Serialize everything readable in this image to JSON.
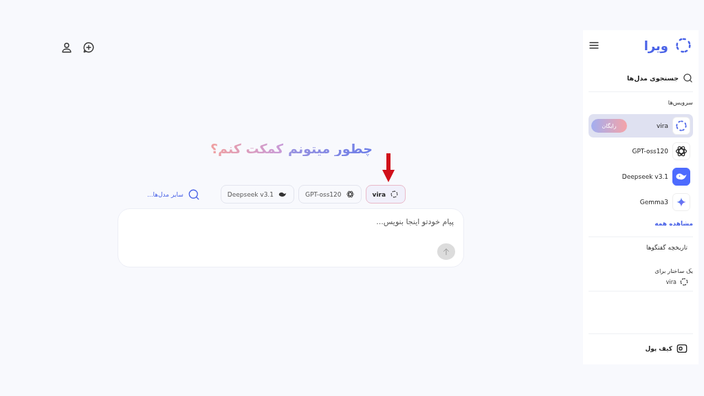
{
  "header": {
    "actions": [
      {
        "kind": "profile"
      },
      {
        "kind": "new-chat"
      }
    ]
  },
  "hero": {
    "title_part_1": "چطور میتونم",
    "title_part_2": "کمکت کنم؟"
  },
  "model_chips": [
    {
      "label": "vira",
      "kind": "vira",
      "selected": true
    },
    {
      "label": "GPT-oss120",
      "kind": "gpt",
      "selected": false
    },
    {
      "label": "Deepseek v3.1",
      "kind": "deepseek",
      "selected": false
    }
  ],
  "more_models": "سایر مدل‌ها...",
  "composer": {
    "placeholder": "پیام خودتو اینجا بنویس..."
  },
  "sidebar": {
    "logo": "ویرا",
    "search_label": "جستجوی مدل‌ها",
    "services_title": "سرویس‌ها",
    "services": [
      {
        "name": "vira",
        "kind": "vira",
        "selected": true,
        "badge": "رایگان"
      },
      {
        "name": "GPT-oss120",
        "kind": "gpt",
        "selected": false
      },
      {
        "name": "Deepseek v3.1",
        "kind": "deepseek",
        "selected": false
      },
      {
        "name": "Gemma3",
        "kind": "gemma",
        "selected": false
      }
    ],
    "view_all": "مشاهده همه",
    "history_title": "تاریخچه گفتگوها",
    "history": [
      {
        "title": "یک ساختار برای",
        "model": "vira",
        "kind": "vira"
      }
    ],
    "wallet": "کیف پول"
  }
}
